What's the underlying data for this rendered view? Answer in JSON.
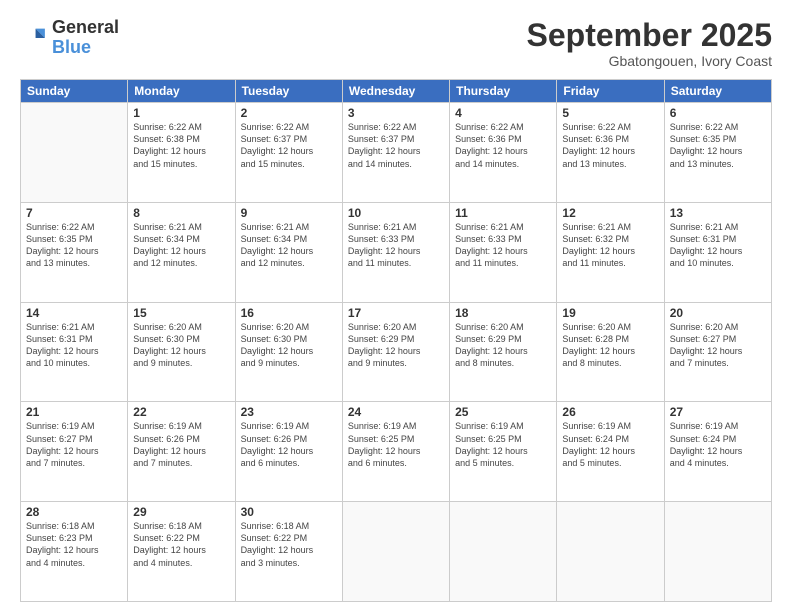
{
  "header": {
    "logo_general": "General",
    "logo_blue": "Blue",
    "month_title": "September 2025",
    "location": "Gbatongouen, Ivory Coast"
  },
  "weekdays": [
    "Sunday",
    "Monday",
    "Tuesday",
    "Wednesday",
    "Thursday",
    "Friday",
    "Saturday"
  ],
  "weeks": [
    [
      {
        "day": "",
        "info": ""
      },
      {
        "day": "1",
        "info": "Sunrise: 6:22 AM\nSunset: 6:38 PM\nDaylight: 12 hours\nand 15 minutes."
      },
      {
        "day": "2",
        "info": "Sunrise: 6:22 AM\nSunset: 6:37 PM\nDaylight: 12 hours\nand 15 minutes."
      },
      {
        "day": "3",
        "info": "Sunrise: 6:22 AM\nSunset: 6:37 PM\nDaylight: 12 hours\nand 14 minutes."
      },
      {
        "day": "4",
        "info": "Sunrise: 6:22 AM\nSunset: 6:36 PM\nDaylight: 12 hours\nand 14 minutes."
      },
      {
        "day": "5",
        "info": "Sunrise: 6:22 AM\nSunset: 6:36 PM\nDaylight: 12 hours\nand 13 minutes."
      },
      {
        "day": "6",
        "info": "Sunrise: 6:22 AM\nSunset: 6:35 PM\nDaylight: 12 hours\nand 13 minutes."
      }
    ],
    [
      {
        "day": "7",
        "info": "Sunrise: 6:22 AM\nSunset: 6:35 PM\nDaylight: 12 hours\nand 13 minutes."
      },
      {
        "day": "8",
        "info": "Sunrise: 6:21 AM\nSunset: 6:34 PM\nDaylight: 12 hours\nand 12 minutes."
      },
      {
        "day": "9",
        "info": "Sunrise: 6:21 AM\nSunset: 6:34 PM\nDaylight: 12 hours\nand 12 minutes."
      },
      {
        "day": "10",
        "info": "Sunrise: 6:21 AM\nSunset: 6:33 PM\nDaylight: 12 hours\nand 11 minutes."
      },
      {
        "day": "11",
        "info": "Sunrise: 6:21 AM\nSunset: 6:33 PM\nDaylight: 12 hours\nand 11 minutes."
      },
      {
        "day": "12",
        "info": "Sunrise: 6:21 AM\nSunset: 6:32 PM\nDaylight: 12 hours\nand 11 minutes."
      },
      {
        "day": "13",
        "info": "Sunrise: 6:21 AM\nSunset: 6:31 PM\nDaylight: 12 hours\nand 10 minutes."
      }
    ],
    [
      {
        "day": "14",
        "info": "Sunrise: 6:21 AM\nSunset: 6:31 PM\nDaylight: 12 hours\nand 10 minutes."
      },
      {
        "day": "15",
        "info": "Sunrise: 6:20 AM\nSunset: 6:30 PM\nDaylight: 12 hours\nand 9 minutes."
      },
      {
        "day": "16",
        "info": "Sunrise: 6:20 AM\nSunset: 6:30 PM\nDaylight: 12 hours\nand 9 minutes."
      },
      {
        "day": "17",
        "info": "Sunrise: 6:20 AM\nSunset: 6:29 PM\nDaylight: 12 hours\nand 9 minutes."
      },
      {
        "day": "18",
        "info": "Sunrise: 6:20 AM\nSunset: 6:29 PM\nDaylight: 12 hours\nand 8 minutes."
      },
      {
        "day": "19",
        "info": "Sunrise: 6:20 AM\nSunset: 6:28 PM\nDaylight: 12 hours\nand 8 minutes."
      },
      {
        "day": "20",
        "info": "Sunrise: 6:20 AM\nSunset: 6:27 PM\nDaylight: 12 hours\nand 7 minutes."
      }
    ],
    [
      {
        "day": "21",
        "info": "Sunrise: 6:19 AM\nSunset: 6:27 PM\nDaylight: 12 hours\nand 7 minutes."
      },
      {
        "day": "22",
        "info": "Sunrise: 6:19 AM\nSunset: 6:26 PM\nDaylight: 12 hours\nand 7 minutes."
      },
      {
        "day": "23",
        "info": "Sunrise: 6:19 AM\nSunset: 6:26 PM\nDaylight: 12 hours\nand 6 minutes."
      },
      {
        "day": "24",
        "info": "Sunrise: 6:19 AM\nSunset: 6:25 PM\nDaylight: 12 hours\nand 6 minutes."
      },
      {
        "day": "25",
        "info": "Sunrise: 6:19 AM\nSunset: 6:25 PM\nDaylight: 12 hours\nand 5 minutes."
      },
      {
        "day": "26",
        "info": "Sunrise: 6:19 AM\nSunset: 6:24 PM\nDaylight: 12 hours\nand 5 minutes."
      },
      {
        "day": "27",
        "info": "Sunrise: 6:19 AM\nSunset: 6:24 PM\nDaylight: 12 hours\nand 4 minutes."
      }
    ],
    [
      {
        "day": "28",
        "info": "Sunrise: 6:18 AM\nSunset: 6:23 PM\nDaylight: 12 hours\nand 4 minutes."
      },
      {
        "day": "29",
        "info": "Sunrise: 6:18 AM\nSunset: 6:22 PM\nDaylight: 12 hours\nand 4 minutes."
      },
      {
        "day": "30",
        "info": "Sunrise: 6:18 AM\nSunset: 6:22 PM\nDaylight: 12 hours\nand 3 minutes."
      },
      {
        "day": "",
        "info": ""
      },
      {
        "day": "",
        "info": ""
      },
      {
        "day": "",
        "info": ""
      },
      {
        "day": "",
        "info": ""
      }
    ]
  ]
}
